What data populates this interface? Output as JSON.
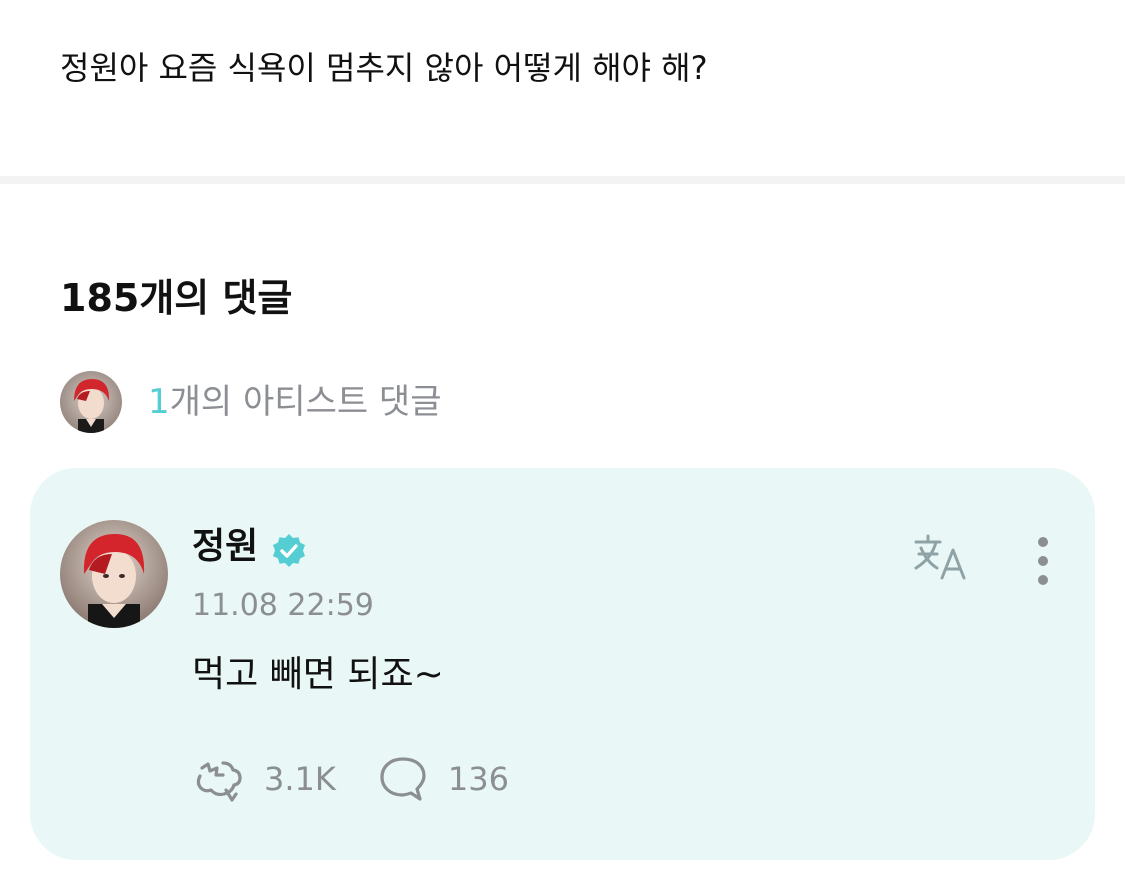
{
  "post": {
    "text": "정원아 요즘 식욕이 멈추지 않아 어떻게 해야 해?"
  },
  "comments_header": {
    "title": "185개의 댓글"
  },
  "artist_comments": {
    "count": "1",
    "label": "개의 아티스트 댓글"
  },
  "comment": {
    "author": "정원",
    "verified": true,
    "timestamp": "11.08 22:59",
    "text": "먹고 빼면 되죠~",
    "likes": "3.1K",
    "replies": "136"
  },
  "icons": {
    "translate": "translate-icon",
    "more": "more-vertical-icon",
    "like": "like-icon",
    "reply": "reply-bubble-icon",
    "verified": "verified-badge-icon"
  },
  "colors": {
    "accent": "#54cdd3",
    "card_background": "#e9f8f6",
    "muted_text": "#8b8e93",
    "primary_text": "#111111"
  }
}
